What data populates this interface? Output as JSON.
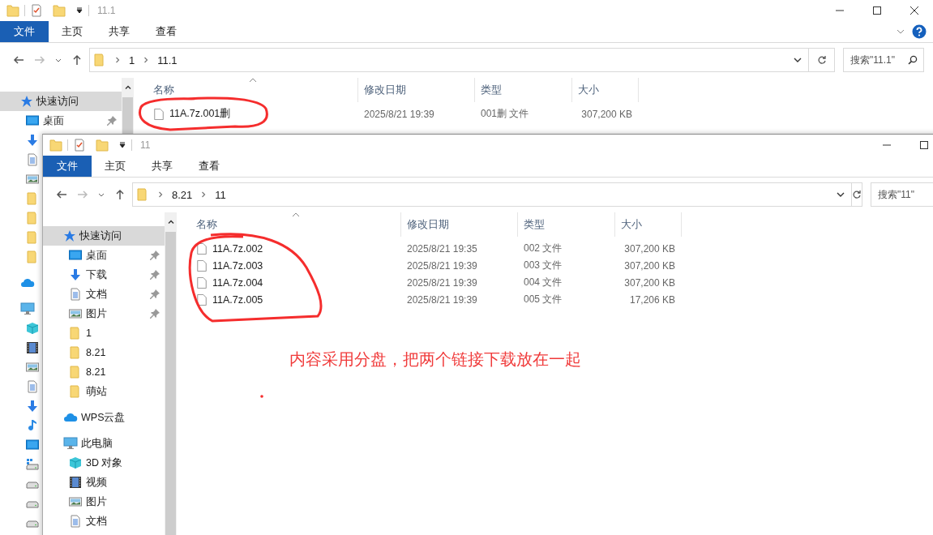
{
  "windows": [
    {
      "title": "11.1",
      "ribbon_tabs": [
        {
          "label": "文件",
          "kind": "file"
        },
        {
          "label": "主页",
          "kind": "tab"
        },
        {
          "label": "共享",
          "kind": "tab"
        },
        {
          "label": "查看",
          "kind": "tab"
        }
      ],
      "help": true,
      "window_buttons": [
        {
          "kind": "minimize"
        },
        {
          "kind": "maximize"
        },
        {
          "kind": "close"
        }
      ],
      "path": [
        "1",
        "11.1"
      ],
      "search": {
        "placeholder": "搜索\"11.1\""
      },
      "sidebar": [
        {
          "label": "快速访问",
          "kind": "star",
          "selected": true,
          "pinned": false,
          "children": [
            {
              "label": "桌面",
              "kind": "desktop",
              "selected": false,
              "pinned": true
            },
            {
              "kind": "download"
            },
            {
              "kind": "document"
            },
            {
              "kind": "picture"
            },
            {
              "kind": "folder"
            },
            {
              "kind": "folder"
            },
            {
              "kind": "folder"
            },
            {
              "kind": "folder"
            }
          ]
        },
        {
          "kind": "cloud"
        },
        {
          "kind": "pc",
          "children": [
            {
              "kind": "cube"
            },
            {
              "kind": "video"
            },
            {
              "kind": "picture"
            },
            {
              "kind": "document"
            },
            {
              "kind": "download"
            },
            {
              "kind": "music"
            },
            {
              "kind": "desktop"
            },
            {
              "kind": "system-drive"
            },
            {
              "kind": "drive"
            },
            {
              "kind": "drive"
            },
            {
              "kind": "drive"
            }
          ]
        }
      ],
      "columns": [
        "名称",
        "修改日期",
        "类型",
        "大小"
      ],
      "files": [
        {
          "name": "11A.7z.001删",
          "modified": "2025/8/21 19:39",
          "type": "001删 文件",
          "size": "307,200 KB"
        }
      ]
    },
    {
      "title": "11",
      "ribbon_tabs": [
        {
          "label": "文件",
          "kind": "file"
        },
        {
          "label": "主页",
          "kind": "tab"
        },
        {
          "label": "共享",
          "kind": "tab"
        },
        {
          "label": "查看",
          "kind": "tab"
        }
      ],
      "window_buttons": [
        {
          "kind": "minimize"
        },
        {
          "kind": "maximize"
        }
      ],
      "path": [
        "8.21",
        "11"
      ],
      "search": {
        "placeholder": "搜索\"11\""
      },
      "sidebar": [
        {
          "label": "快速访问",
          "kind": "star",
          "selected": true,
          "pinned": false,
          "children": [
            {
              "label": "桌面",
              "kind": "desktop",
              "selected": false,
              "pinned": true
            },
            {
              "label": "下载",
              "kind": "download",
              "selected": false,
              "pinned": true
            },
            {
              "label": "文档",
              "kind": "document",
              "selected": false,
              "pinned": true
            },
            {
              "label": "图片",
              "kind": "picture",
              "selected": false,
              "pinned": true
            },
            {
              "label": "1",
              "kind": "folder",
              "selected": false,
              "pinned": false
            },
            {
              "label": "8.21",
              "kind": "folder",
              "selected": false,
              "pinned": false
            },
            {
              "label": "8.21",
              "kind": "folder",
              "selected": false,
              "pinned": false
            },
            {
              "label": "萌站",
              "kind": "folder",
              "selected": false,
              "pinned": false
            }
          ]
        },
        {
          "label": "WPS云盘",
          "kind": "cloud",
          "selected": false,
          "pinned": false
        },
        {
          "label": "此电脑",
          "kind": "pc",
          "selected": false,
          "pinned": false,
          "children": [
            {
              "label": "3D 对象",
              "kind": "cube",
              "selected": false,
              "pinned": false
            },
            {
              "label": "视频",
              "kind": "video",
              "selected": false,
              "pinned": false
            },
            {
              "label": "图片",
              "kind": "picture",
              "selected": false,
              "pinned": false
            },
            {
              "label": "文档",
              "kind": "document",
              "selected": false,
              "pinned": false
            }
          ]
        }
      ],
      "columns": [
        "名称",
        "修改日期",
        "类型",
        "大小"
      ],
      "files": [
        {
          "name": "11A.7z.002",
          "modified": "2025/8/21 19:35",
          "type": "002 文件",
          "size": "307,200 KB"
        },
        {
          "name": "11A.7z.003",
          "modified": "2025/8/21 19:39",
          "type": "003 文件",
          "size": "307,200 KB"
        },
        {
          "name": "11A.7z.004",
          "modified": "2025/8/21 19:39",
          "type": "004 文件",
          "size": "307,200 KB"
        },
        {
          "name": "11A.7z.005",
          "modified": "2025/8/21 19:39",
          "type": "005 文件",
          "size": "17,206 KB"
        }
      ]
    }
  ],
  "annotation": {
    "text": "内容采用分盘，把两个链接下载放在一起"
  }
}
